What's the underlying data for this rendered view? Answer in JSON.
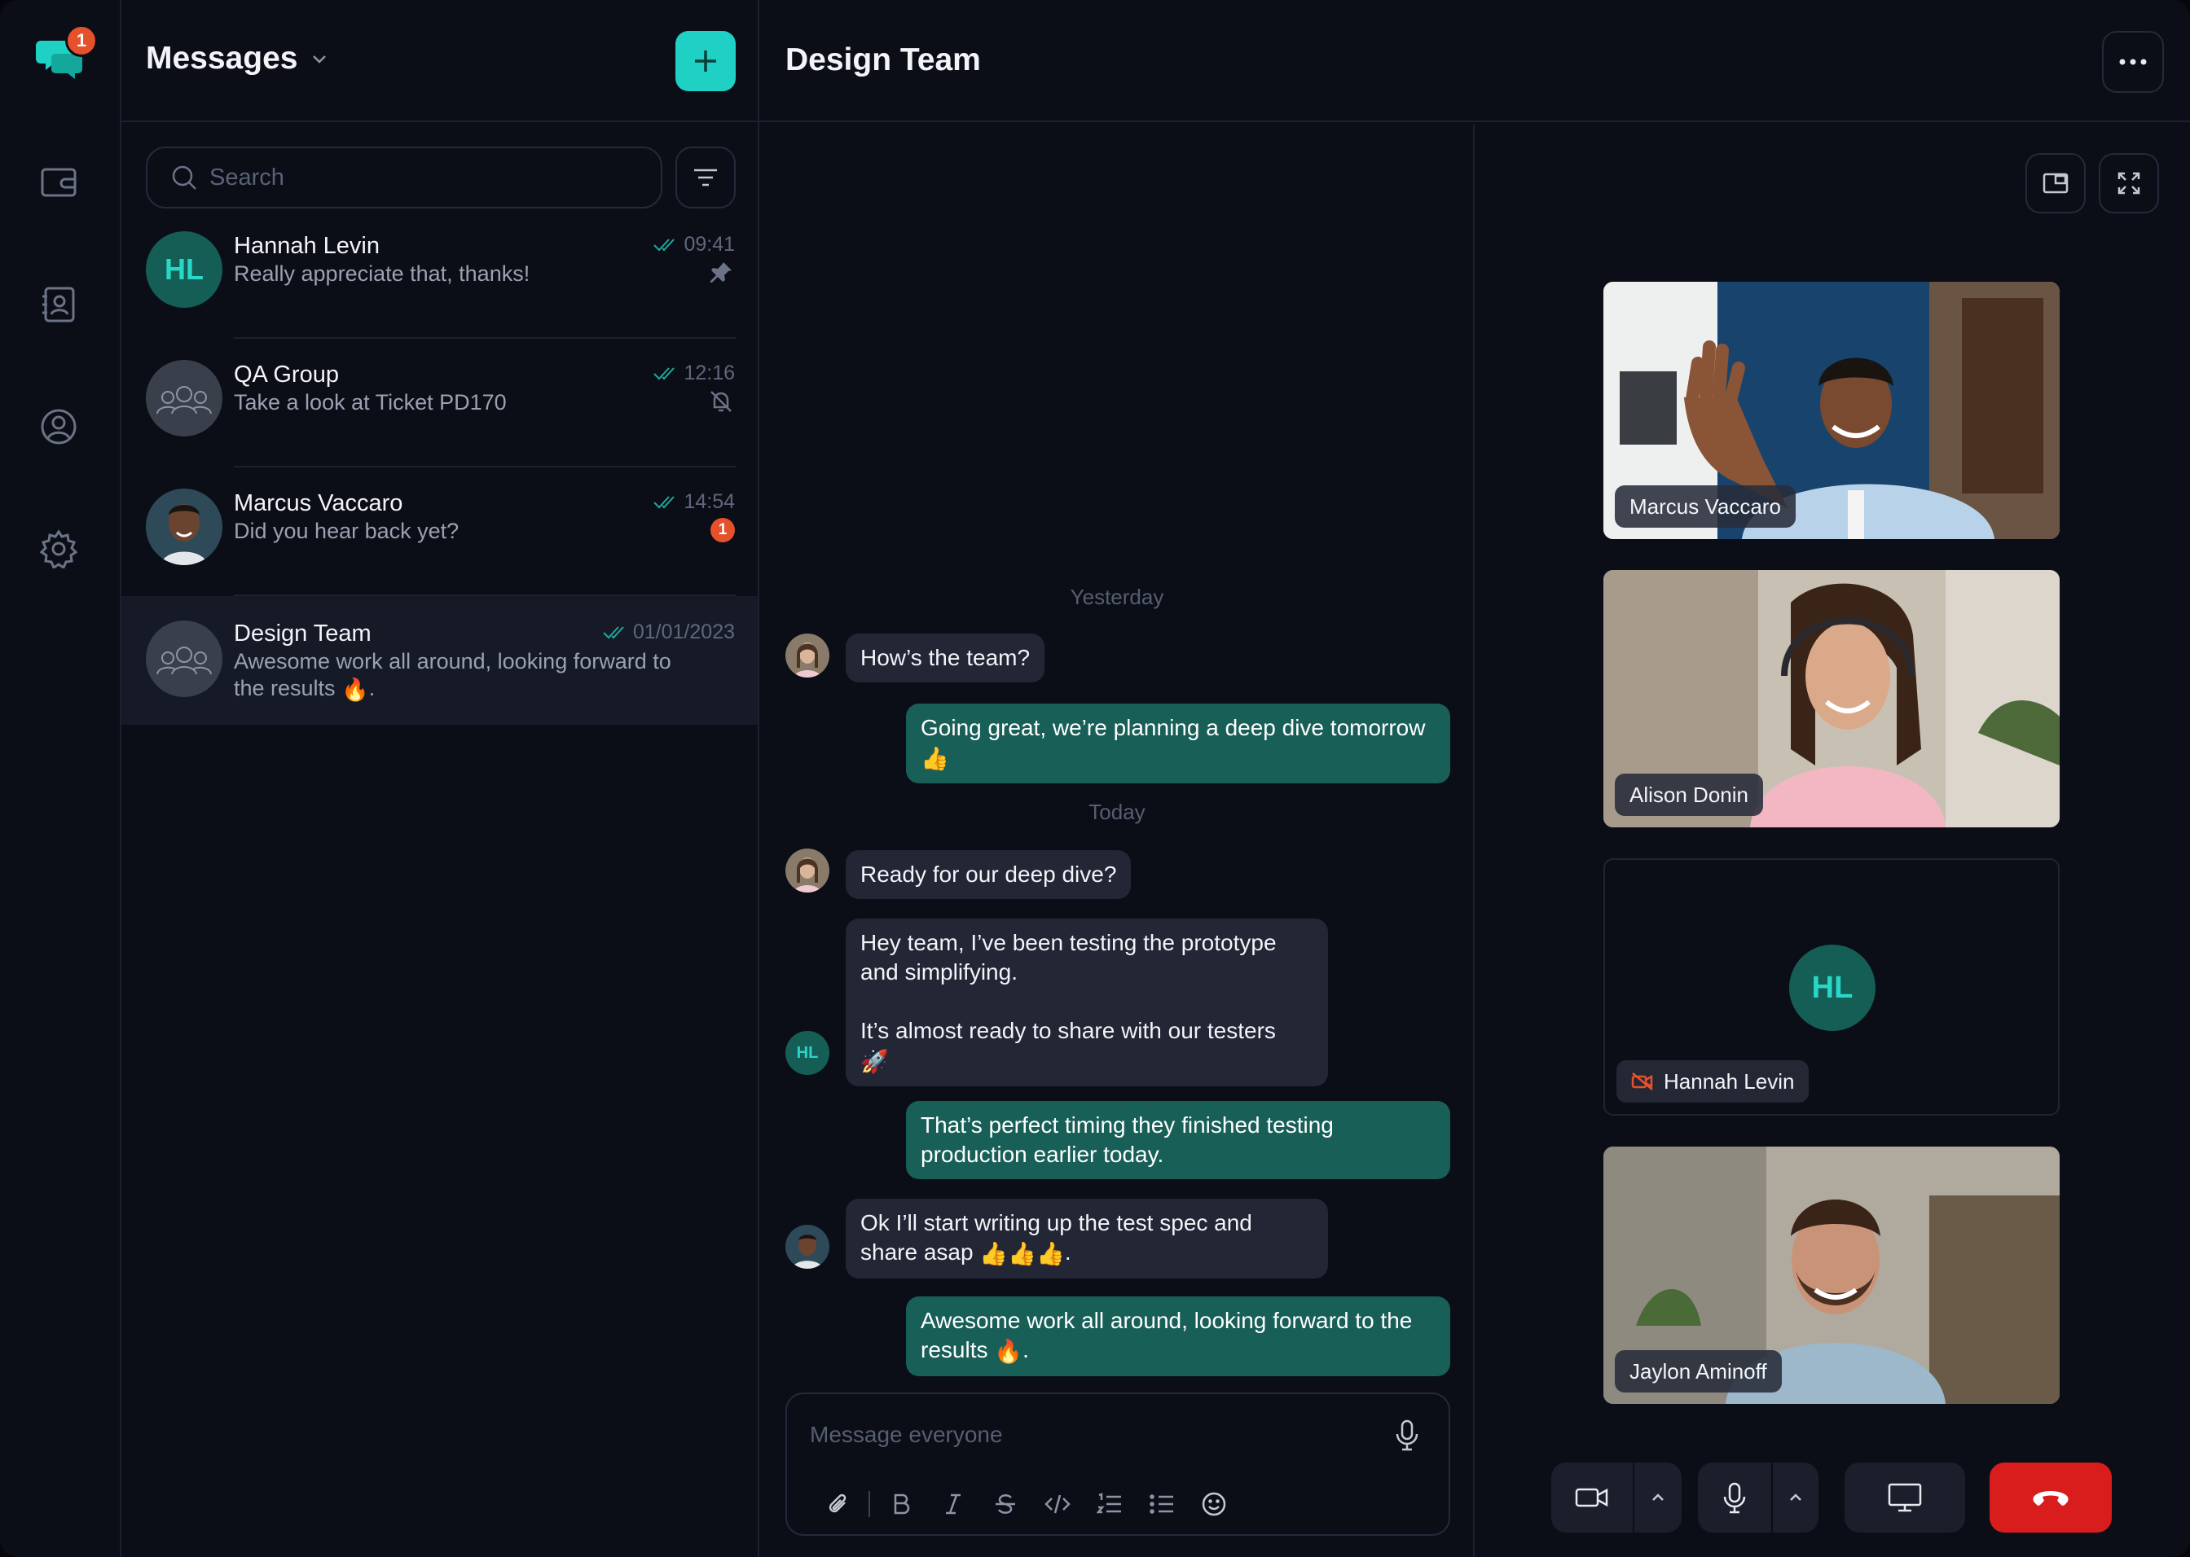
{
  "rail": {
    "badge": "1",
    "items": [
      {
        "icon": "wallet-icon"
      },
      {
        "icon": "contacts-icon"
      },
      {
        "icon": "profile-icon"
      },
      {
        "icon": "settings-icon"
      }
    ]
  },
  "list": {
    "title": "Messages",
    "search_placeholder": "Search",
    "conversations": [
      {
        "initials": "HL",
        "name": "Hannah Levin",
        "preview": "Really appreciate that, thanks!",
        "time": "09:41",
        "state": "pin-icon"
      },
      {
        "name": "QA Group",
        "preview": "Take a look at Ticket PD170",
        "time": "12:16",
        "state": "muted-bell-icon"
      },
      {
        "name": "Marcus Vaccaro",
        "preview": "Did you hear back yet?",
        "time": "14:54",
        "unread": "1"
      },
      {
        "name": "Design Team",
        "preview": "Awesome work all around, looking forward to the results",
        "preview_emoji": "🔥",
        "preview_end": ".",
        "time": "01/01/2023"
      }
    ]
  },
  "chat": {
    "title": "Design Team",
    "days": {
      "yesterday": "Yesterday",
      "today": "Today"
    },
    "messages": [
      {
        "dir": "in",
        "text": "How’s the team?"
      },
      {
        "dir": "out",
        "text": "Going great, we’re planning a deep dive tomorrow",
        "emoji": "👍"
      },
      {
        "dir": "in",
        "text": "Ready for our deep dive?"
      },
      {
        "dir": "in",
        "sender_initials": "HL",
        "text": "Hey team, I’ve been testing the prototype and simplifying.",
        "text2": "It’s almost ready to share with our testers",
        "emoji": "🚀"
      },
      {
        "dir": "out",
        "text": "That’s perfect timing they finished testing production earlier today."
      },
      {
        "dir": "in",
        "text": "Ok I’ll start writing up the test spec and share asap",
        "emoji": "👍👍👍",
        "end": "."
      },
      {
        "dir": "out",
        "text": "Awesome work all around, looking forward to the results",
        "emoji": "🔥",
        "end": "."
      }
    ],
    "composer_placeholder": "Message everyone"
  },
  "video": {
    "participants": [
      {
        "name": "Marcus Vaccaro"
      },
      {
        "name": "Alison Donin"
      },
      {
        "name": "Hannah Levin",
        "initials": "HL",
        "camera": "off"
      },
      {
        "name": "Jaylon Aminoff"
      }
    ]
  },
  "colors": {
    "accent": "#1fd1c5",
    "outgoing": "#185f58",
    "badge": "#e5512a",
    "end_call": "#d91c1c"
  }
}
